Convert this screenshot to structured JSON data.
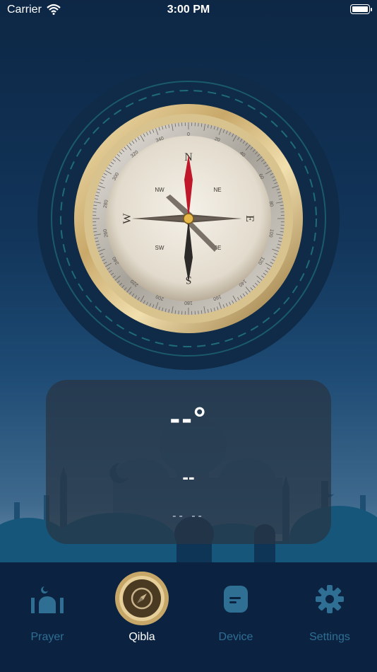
{
  "status_bar": {
    "carrier": "Carrier",
    "time": "3:00 PM"
  },
  "compass": {
    "cardinals": [
      "N",
      "E",
      "S",
      "W"
    ],
    "intercardinals": [
      "NE",
      "SE",
      "SW",
      "NW"
    ],
    "tick_labels": [
      "0",
      "20",
      "40",
      "60",
      "80",
      "100",
      "120",
      "140",
      "160",
      "180",
      "200",
      "220",
      "240",
      "260",
      "280",
      "300",
      "320",
      "340"
    ]
  },
  "qibla": {
    "degree": "--°",
    "distance": "--",
    "subtitle": "--  --"
  },
  "tabs": [
    {
      "label": "Prayer",
      "icon": "mosque-icon",
      "active": false
    },
    {
      "label": "Qibla",
      "icon": "compass-icon",
      "active": true
    },
    {
      "label": "Device",
      "icon": "device-icon",
      "active": false
    },
    {
      "label": "Settings",
      "icon": "gear-icon",
      "active": false
    }
  ],
  "colors": {
    "accent_gold": "#c9a96a",
    "inactive_tab": "#2f6f94",
    "needle_red": "#c0182a"
  }
}
